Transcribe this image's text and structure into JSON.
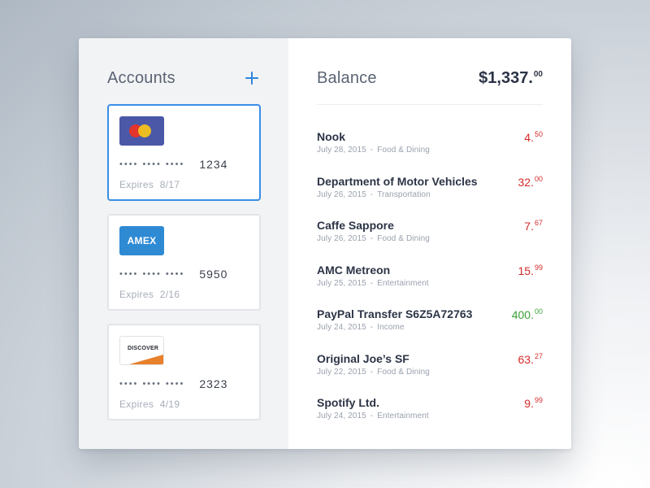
{
  "accounts": {
    "title": "Accounts",
    "add_icon": "plus-icon",
    "cards": [
      {
        "brand": "mastercard",
        "dots": "•••• •••• ••••",
        "last4": "1234",
        "expires_label": "Expires",
        "expires": "8/17",
        "selected": true
      },
      {
        "brand": "amex",
        "logo_text": "AMEX",
        "dots": "•••• •••• ••••",
        "last4": "5950",
        "expires_label": "Expires",
        "expires": "2/16",
        "selected": false
      },
      {
        "brand": "discover",
        "logo_text": "DISCOVER",
        "dots": "•••• •••• ••••",
        "last4": "2323",
        "expires_label": "Expires",
        "expires": "4/19",
        "selected": false
      }
    ]
  },
  "balance": {
    "label": "Balance",
    "amount": "$1,337.",
    "cents": "00"
  },
  "transactions": [
    {
      "name": "Nook",
      "date": "July 28, 2015",
      "category": "Food & Dining",
      "amount": "4.",
      "cents": "50",
      "type": "expense"
    },
    {
      "name": "Department of Motor Vehicles",
      "date": "July 26, 2015",
      "category": "Transportation",
      "amount": "32.",
      "cents": "00",
      "type": "expense"
    },
    {
      "name": "Caffe Sappore",
      "date": "July 26, 2015",
      "category": "Food & Dining",
      "amount": "7.",
      "cents": "67",
      "type": "expense"
    },
    {
      "name": "AMC Metreon",
      "date": "July 25, 2015",
      "category": "Entertainment",
      "amount": "15.",
      "cents": "99",
      "type": "expense"
    },
    {
      "name": "PayPal Transfer S6Z5A72763",
      "date": "July 24, 2015",
      "category": "Income",
      "amount": "400.",
      "cents": "00",
      "type": "income"
    },
    {
      "name": "Original Joe’s SF",
      "date": "July 22, 2015",
      "category": "Food & Dining",
      "amount": "63.",
      "cents": "27",
      "type": "expense"
    },
    {
      "name": "Spotify Ltd.",
      "date": "July 24, 2015",
      "category": "Entertainment",
      "amount": "9.",
      "cents": "99",
      "type": "expense"
    }
  ],
  "colors": {
    "accent": "#2f86db",
    "expense": "#d42a2a",
    "income": "#3aa136",
    "text_dark": "#2c3446"
  }
}
